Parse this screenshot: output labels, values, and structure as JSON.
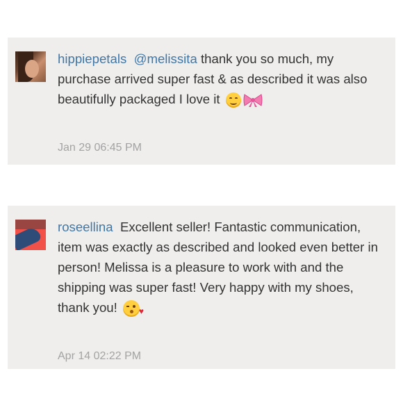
{
  "comments": [
    {
      "username": "hippiepetals",
      "mention": "@melissita",
      "text": "thank you so much, my purchase arrived super fast & as described it was also beautifully packaged I love it",
      "emojis": [
        "smiling-face-icon",
        "ribbon-bow-icon"
      ],
      "timestamp": "Jan 29 06:45 PM"
    },
    {
      "username": "roseellina",
      "text": "Excellent seller! Fantastic communication, item was exactly as described and looked even better in person! Melissa is a pleasure to work with and the shipping was super fast! Very happy with my shoes, thank you!",
      "emojis": [
        "face-blowing-kiss-icon"
      ],
      "timestamp": "Apr 14 02:22 PM"
    }
  ],
  "colors": {
    "card_background": "#efeeec",
    "username": "#3e77a8",
    "body_text": "#333333",
    "timestamp": "#a3a3a3"
  }
}
